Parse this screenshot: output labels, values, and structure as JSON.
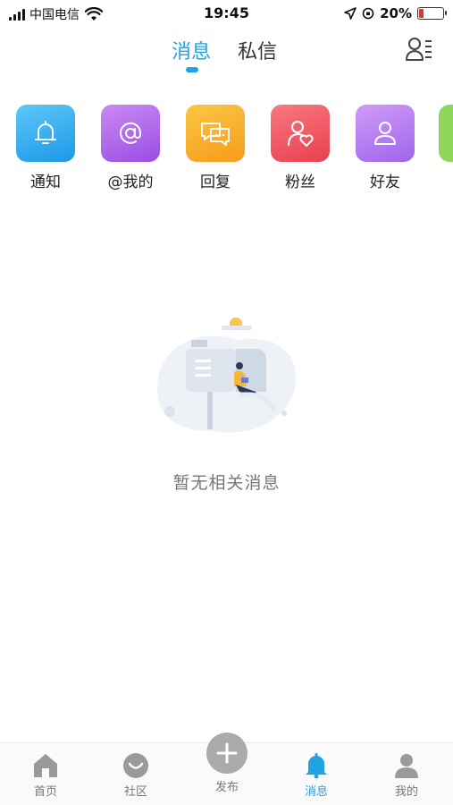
{
  "status_bar": {
    "carrier": "中国电信",
    "time": "19:45",
    "battery": "20%",
    "battery_level": 0.2
  },
  "header": {
    "tabs": [
      {
        "label": "消息",
        "active": true
      },
      {
        "label": "私信",
        "active": false
      }
    ],
    "accent_color": "#1fa3e6"
  },
  "categories": [
    {
      "label": "通知",
      "icon": "bell-icon",
      "color": "#2aa9f0"
    },
    {
      "label": "@我的",
      "icon": "at-icon",
      "color": "#b061ea"
    },
    {
      "label": "回复",
      "icon": "chat-bubbles-icon",
      "color": "#f9b32c"
    },
    {
      "label": "粉丝",
      "icon": "fan-heart-icon",
      "color": "#f05b6a"
    },
    {
      "label": "好友",
      "icon": "person-icon",
      "color": "#b57cf2"
    },
    {
      "label": "…",
      "icon": "partial-icon",
      "color": "#8fd65b"
    }
  ],
  "empty_state": {
    "message": "暂无相关消息",
    "illustration": "mailbox-reading-illustration"
  },
  "tab_bar": {
    "items": [
      {
        "label": "首页",
        "icon": "home-icon",
        "active": false
      },
      {
        "label": "社区",
        "icon": "community-icon",
        "active": false
      },
      {
        "label": "发布",
        "icon": "plus-icon",
        "active": false
      },
      {
        "label": "消息",
        "icon": "bell-icon",
        "active": true
      },
      {
        "label": "我的",
        "icon": "profile-icon",
        "active": false
      }
    ]
  }
}
